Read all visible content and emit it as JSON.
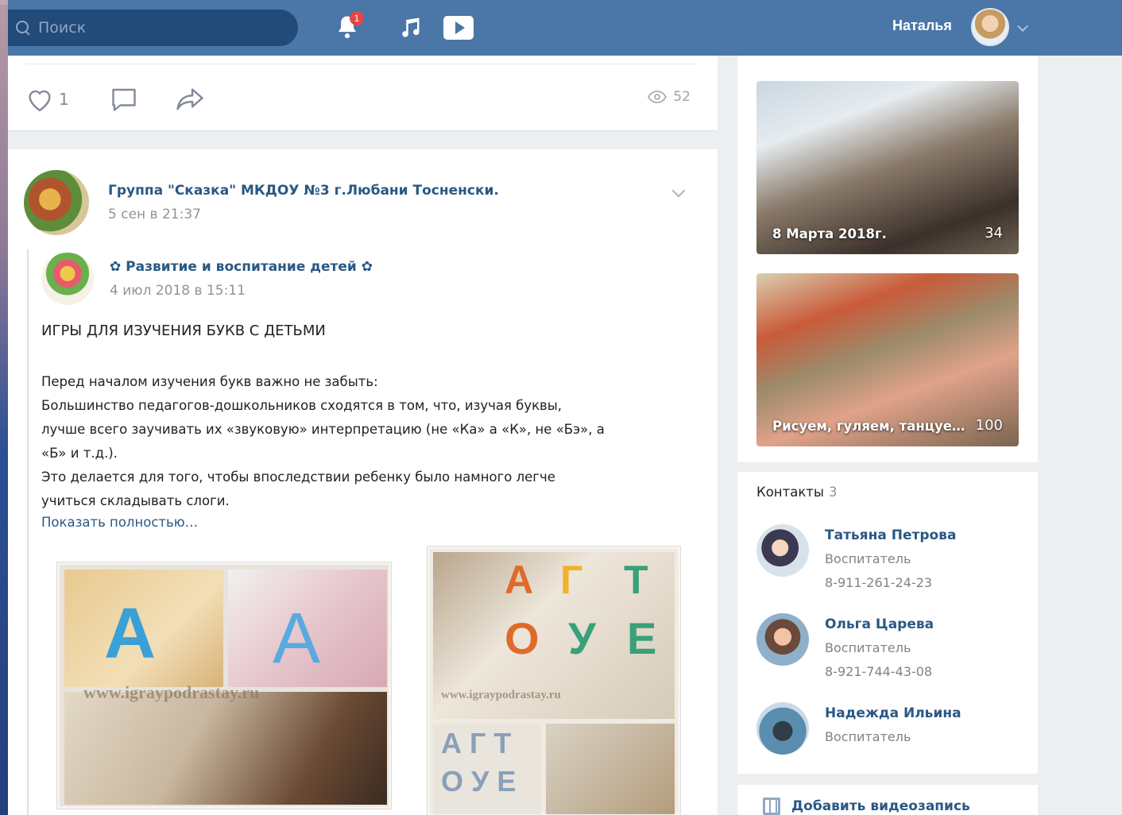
{
  "header": {
    "search_placeholder": "Поиск",
    "notification_count": "1",
    "user_name": "Наталья"
  },
  "post_actions": {
    "likes": "1",
    "views": "52"
  },
  "post": {
    "group_name": "Группа \"Сказка\" МКДОУ №3 г.Любани Тосненски.",
    "date": "5 сен в 21:37",
    "repost": {
      "source_name": "✿ Развитие и воспитание детей ✿",
      "date": "4 июл 2018 в 15:11"
    },
    "title": "ИГРЫ ДЛЯ ИЗУЧЕНИЯ БУКВ С ДЕТЬМИ",
    "body_lines": [
      "Перед началом изучения букв важно не забыть:",
      "Большинство педагогов-дошкольников сходятся в том, что, изучая буквы,",
      "лучше всего заучивать их «звуковую» интерпретацию (не «Ка» а «К», не «Бэ», а",
      "«Б» и т.д.).",
      "Это делается для того, чтобы впоследствии ребенку было намного легче",
      "учиться складывать слоги."
    ],
    "show_more": "Показать полностью…",
    "watermark_a": "www.igraypodrastay.ru",
    "watermark_b": "www.igraypodrastay.ru"
  },
  "albums": [
    {
      "caption": "8 Марта 2018г.",
      "count": "34"
    },
    {
      "caption": "Рисуем, гуляем, танцуе…",
      "count": "100"
    }
  ],
  "contacts": {
    "title": "Контакты",
    "count": "3",
    "items": [
      {
        "name": "Татьяна Петрова",
        "role": "Воспитатель",
        "phone": "8-911-261-24-23"
      },
      {
        "name": "Ольга Царева",
        "role": "Воспитатель",
        "phone": "8-921-744-43-08"
      },
      {
        "name": "Надежда Ильина",
        "role": "Воспитатель",
        "phone": ""
      }
    ]
  },
  "video": {
    "add_label": "Добавить видеозапись"
  },
  "colors": {
    "header": "#4a76a8",
    "link": "#2a5885",
    "badge": "#e64646"
  }
}
